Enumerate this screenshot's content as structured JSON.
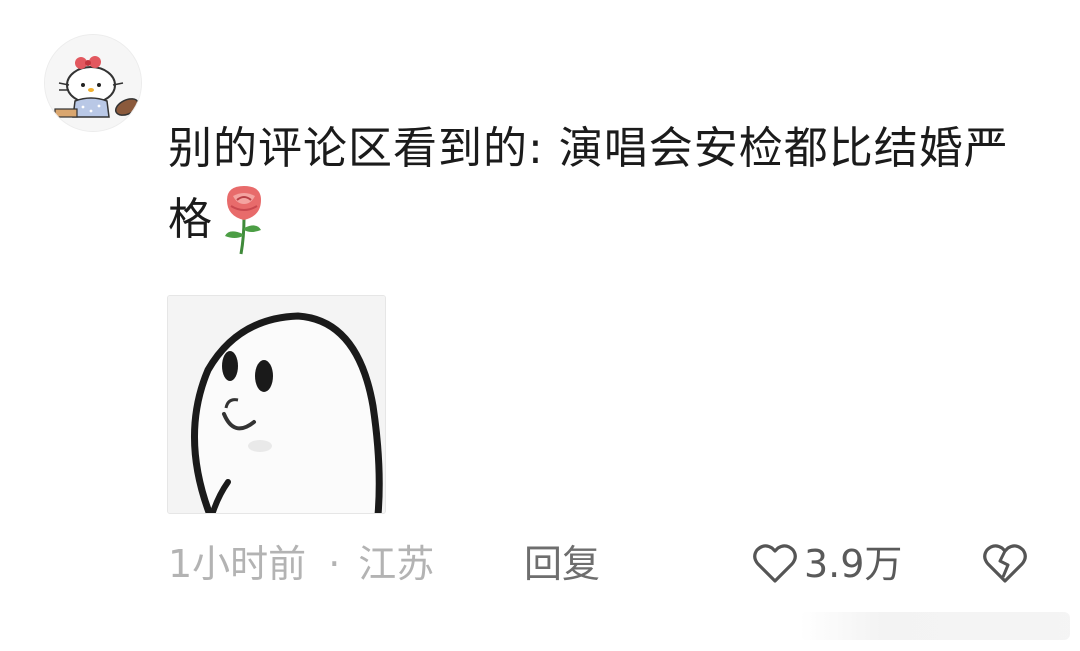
{
  "comment": {
    "text": "别的评论区看到的: 演唱会安检都比结婚严格",
    "avatar_icon": "hello-kitty-avatar",
    "inline_emoji_icon": "rose-icon",
    "sticker_icon": "ghost-sticker",
    "meta": {
      "time": "1小时前",
      "separator": "·",
      "location": "江苏",
      "reply_label": "回复",
      "like_count": "3.9万"
    },
    "icons": {
      "like": "heart-icon",
      "dislike": "broken-heart-icon"
    },
    "colors": {
      "body_text": "#1b1b1b",
      "meta_text": "#b3b3b3",
      "reply_text": "#6e6e6e"
    }
  }
}
